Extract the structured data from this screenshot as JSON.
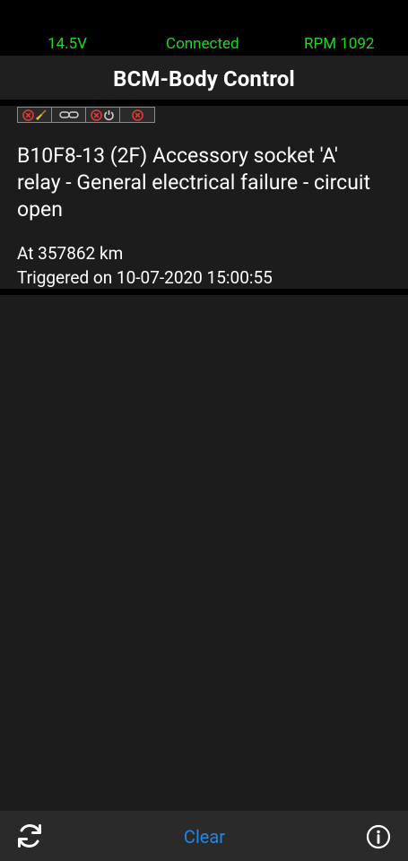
{
  "status": {
    "voltage": "14.5V",
    "connection": "Connected",
    "rpm": "RPM 1092",
    "color": "#20d820"
  },
  "header": {
    "title": "BCM-Body Control"
  },
  "dtc": {
    "flags": [
      {
        "icons": [
          "error-x-icon",
          "broom-icon"
        ]
      },
      {
        "icons": [
          "chain-link-icon"
        ]
      },
      {
        "icons": [
          "error-x-icon",
          "power-icon"
        ]
      },
      {
        "icons": [
          "error-x-icon"
        ]
      }
    ],
    "title": "B10F8-13 (2F) Accessory socket 'A' relay - General electrical failure - circuit open",
    "odometer": "At 357862 km",
    "triggered": "Triggered on 10-07-2020 15:00:55"
  },
  "bottombar": {
    "refresh_icon": "refresh-icon",
    "clear_label": "Clear",
    "clear_color": "#1e88e5",
    "info_icon": "info-icon"
  }
}
